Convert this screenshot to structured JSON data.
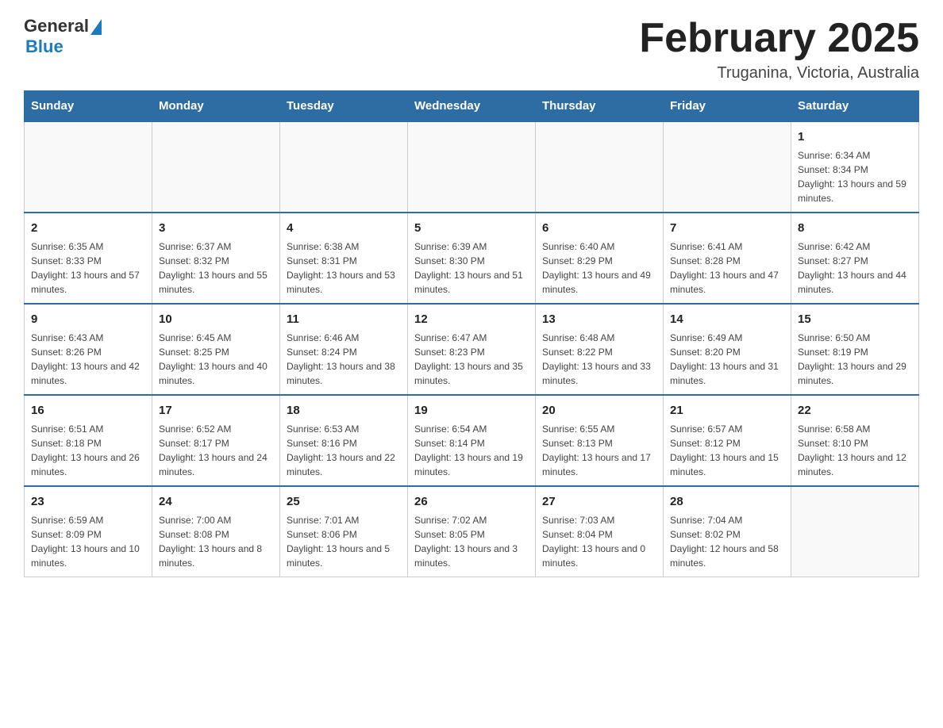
{
  "header": {
    "logo_general": "General",
    "logo_blue": "Blue",
    "month_title": "February 2025",
    "location": "Truganina, Victoria, Australia"
  },
  "days_of_week": [
    "Sunday",
    "Monday",
    "Tuesday",
    "Wednesday",
    "Thursday",
    "Friday",
    "Saturday"
  ],
  "weeks": [
    [
      {
        "day": "",
        "info": ""
      },
      {
        "day": "",
        "info": ""
      },
      {
        "day": "",
        "info": ""
      },
      {
        "day": "",
        "info": ""
      },
      {
        "day": "",
        "info": ""
      },
      {
        "day": "",
        "info": ""
      },
      {
        "day": "1",
        "info": "Sunrise: 6:34 AM\nSunset: 8:34 PM\nDaylight: 13 hours and 59 minutes."
      }
    ],
    [
      {
        "day": "2",
        "info": "Sunrise: 6:35 AM\nSunset: 8:33 PM\nDaylight: 13 hours and 57 minutes."
      },
      {
        "day": "3",
        "info": "Sunrise: 6:37 AM\nSunset: 8:32 PM\nDaylight: 13 hours and 55 minutes."
      },
      {
        "day": "4",
        "info": "Sunrise: 6:38 AM\nSunset: 8:31 PM\nDaylight: 13 hours and 53 minutes."
      },
      {
        "day": "5",
        "info": "Sunrise: 6:39 AM\nSunset: 8:30 PM\nDaylight: 13 hours and 51 minutes."
      },
      {
        "day": "6",
        "info": "Sunrise: 6:40 AM\nSunset: 8:29 PM\nDaylight: 13 hours and 49 minutes."
      },
      {
        "day": "7",
        "info": "Sunrise: 6:41 AM\nSunset: 8:28 PM\nDaylight: 13 hours and 47 minutes."
      },
      {
        "day": "8",
        "info": "Sunrise: 6:42 AM\nSunset: 8:27 PM\nDaylight: 13 hours and 44 minutes."
      }
    ],
    [
      {
        "day": "9",
        "info": "Sunrise: 6:43 AM\nSunset: 8:26 PM\nDaylight: 13 hours and 42 minutes."
      },
      {
        "day": "10",
        "info": "Sunrise: 6:45 AM\nSunset: 8:25 PM\nDaylight: 13 hours and 40 minutes."
      },
      {
        "day": "11",
        "info": "Sunrise: 6:46 AM\nSunset: 8:24 PM\nDaylight: 13 hours and 38 minutes."
      },
      {
        "day": "12",
        "info": "Sunrise: 6:47 AM\nSunset: 8:23 PM\nDaylight: 13 hours and 35 minutes."
      },
      {
        "day": "13",
        "info": "Sunrise: 6:48 AM\nSunset: 8:22 PM\nDaylight: 13 hours and 33 minutes."
      },
      {
        "day": "14",
        "info": "Sunrise: 6:49 AM\nSunset: 8:20 PM\nDaylight: 13 hours and 31 minutes."
      },
      {
        "day": "15",
        "info": "Sunrise: 6:50 AM\nSunset: 8:19 PM\nDaylight: 13 hours and 29 minutes."
      }
    ],
    [
      {
        "day": "16",
        "info": "Sunrise: 6:51 AM\nSunset: 8:18 PM\nDaylight: 13 hours and 26 minutes."
      },
      {
        "day": "17",
        "info": "Sunrise: 6:52 AM\nSunset: 8:17 PM\nDaylight: 13 hours and 24 minutes."
      },
      {
        "day": "18",
        "info": "Sunrise: 6:53 AM\nSunset: 8:16 PM\nDaylight: 13 hours and 22 minutes."
      },
      {
        "day": "19",
        "info": "Sunrise: 6:54 AM\nSunset: 8:14 PM\nDaylight: 13 hours and 19 minutes."
      },
      {
        "day": "20",
        "info": "Sunrise: 6:55 AM\nSunset: 8:13 PM\nDaylight: 13 hours and 17 minutes."
      },
      {
        "day": "21",
        "info": "Sunrise: 6:57 AM\nSunset: 8:12 PM\nDaylight: 13 hours and 15 minutes."
      },
      {
        "day": "22",
        "info": "Sunrise: 6:58 AM\nSunset: 8:10 PM\nDaylight: 13 hours and 12 minutes."
      }
    ],
    [
      {
        "day": "23",
        "info": "Sunrise: 6:59 AM\nSunset: 8:09 PM\nDaylight: 13 hours and 10 minutes."
      },
      {
        "day": "24",
        "info": "Sunrise: 7:00 AM\nSunset: 8:08 PM\nDaylight: 13 hours and 8 minutes."
      },
      {
        "day": "25",
        "info": "Sunrise: 7:01 AM\nSunset: 8:06 PM\nDaylight: 13 hours and 5 minutes."
      },
      {
        "day": "26",
        "info": "Sunrise: 7:02 AM\nSunset: 8:05 PM\nDaylight: 13 hours and 3 minutes."
      },
      {
        "day": "27",
        "info": "Sunrise: 7:03 AM\nSunset: 8:04 PM\nDaylight: 13 hours and 0 minutes."
      },
      {
        "day": "28",
        "info": "Sunrise: 7:04 AM\nSunset: 8:02 PM\nDaylight: 12 hours and 58 minutes."
      },
      {
        "day": "",
        "info": ""
      }
    ]
  ]
}
